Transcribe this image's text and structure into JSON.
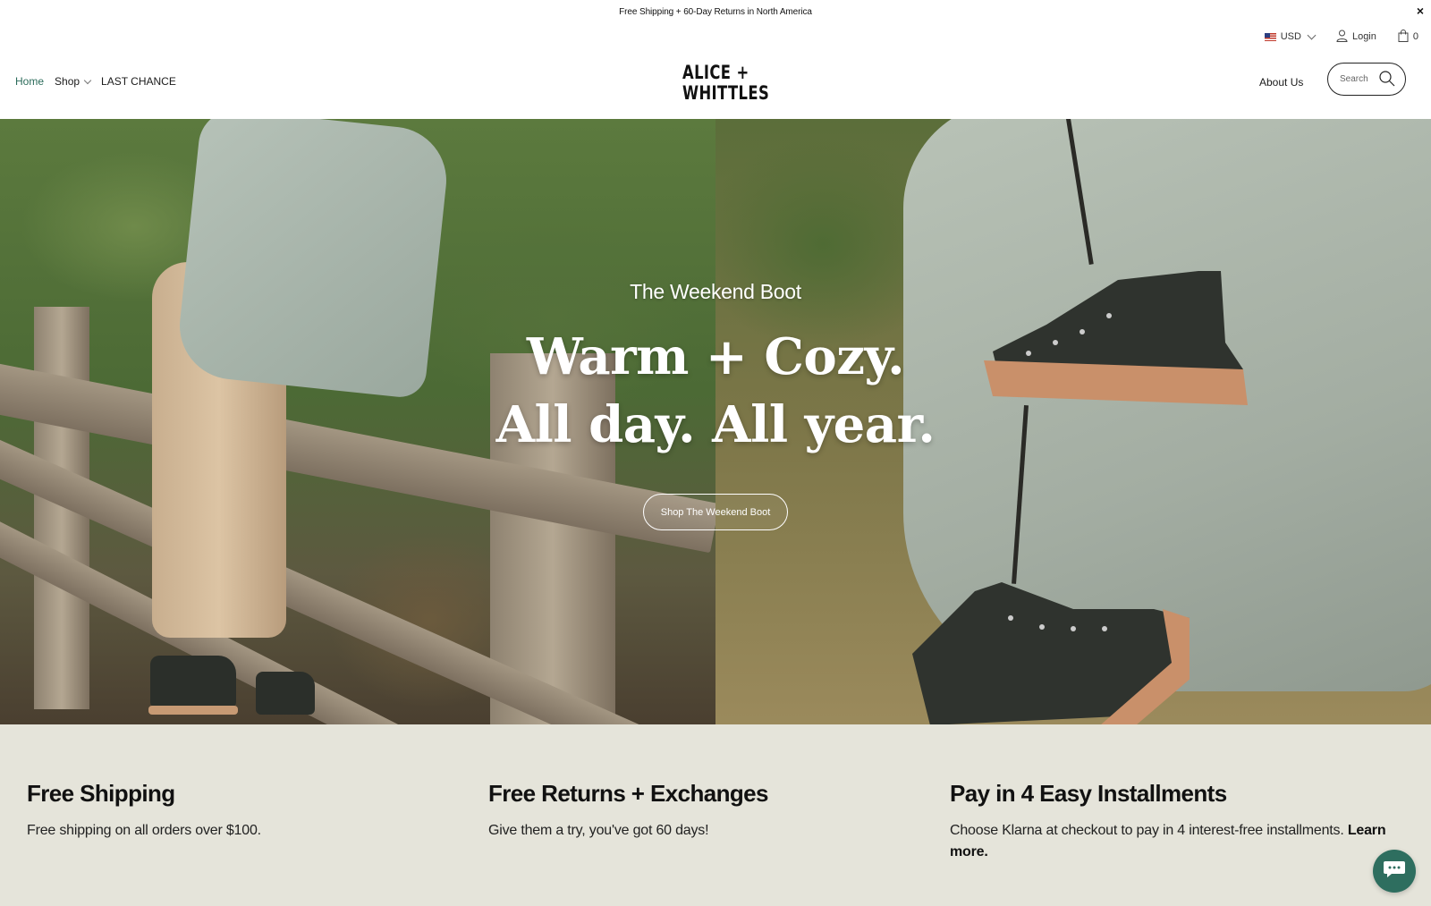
{
  "announcement": {
    "text": "Free Shipping + 60-Day Returns in North America",
    "close_label": "×"
  },
  "utility": {
    "currency": "USD",
    "login_label": "Login",
    "cart_count": "0"
  },
  "nav": {
    "home_label": "Home",
    "shop_label": "Shop",
    "last_chance_label": "LAST CHANCE",
    "about_label": "About Us"
  },
  "logo": {
    "line1": "ALICE +",
    "line2": "WHITTLES"
  },
  "search": {
    "placeholder": "Search"
  },
  "hero": {
    "eyebrow": "The Weekend Boot",
    "headline_line1": "Warm + Cozy.",
    "headline_line2": "All day. All year.",
    "cta_label": "Shop The Weekend Boot"
  },
  "features": [
    {
      "title": "Free Shipping",
      "text": "Free shipping on all orders over $100."
    },
    {
      "title": "Free Returns + Exchanges",
      "text": "Give them a try, you've got 60 days!"
    },
    {
      "title": "Pay in 4 Easy Installments",
      "text": "Choose Klarna at checkout to pay in 4 interest-free installments.",
      "link": "Learn more."
    }
  ],
  "colors": {
    "nav_active": "#2b6b5a",
    "features_bg": "#e5e4da",
    "chat_bg": "#2e6e5f"
  },
  "icons": {
    "user": "user-icon",
    "cart": "shopping-bag-icon",
    "search": "search-icon",
    "chat": "chat-bubble-icon"
  }
}
